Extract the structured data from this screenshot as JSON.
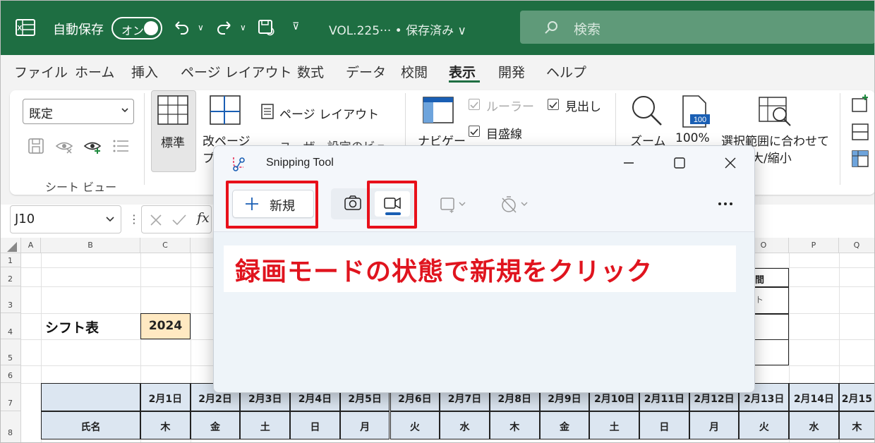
{
  "titlebar": {
    "autosave_label": "自動保存",
    "autosave_toggle": "オン",
    "filename": "VOL.225··· • 保存済み ∨",
    "search_placeholder": "検索",
    "colors": {
      "bg": "#1e6e42"
    }
  },
  "ribbon_tabs": [
    {
      "label": "ファイル"
    },
    {
      "label": "ホーム"
    },
    {
      "label": "挿入"
    },
    {
      "label": "ページ レイアウト"
    },
    {
      "label": "数式"
    },
    {
      "label": "データ"
    },
    {
      "label": "校閲"
    },
    {
      "label": "表示",
      "active": true
    },
    {
      "label": "開発"
    },
    {
      "label": "ヘルプ"
    }
  ],
  "ribbon": {
    "sheet_view_select": "既定",
    "sheet_view_group": "シート ビュー",
    "normal": "標準",
    "page_break_line1": "改ページ",
    "page_break_line2": "プ",
    "page_layout": "ページ レイアウト",
    "custom_view": "ユーザー設定のビュー",
    "navigator": "ナビゲー",
    "ruler": "ルーラー",
    "gridlines": "目盛線",
    "headings": "見出し",
    "zoom": "ズーム",
    "zoom100": "100%",
    "zoom100_icon_text": "100",
    "zoom_selection_line1": "選択範囲に合わせて",
    "zoom_selection_line2": "拡大/縮小"
  },
  "formula_bar": {
    "name_box": "J10",
    "fx": "fx"
  },
  "grid": {
    "col_headers": [
      "A",
      "B",
      "C",
      "O",
      "P",
      "Q"
    ],
    "row_headers": [
      "1",
      "2",
      "3",
      "4",
      "5",
      "6",
      "7",
      "8"
    ],
    "shift_title": "シフト表",
    "year": "2024",
    "right_box_top": "間",
    "right_box_mid": "ト",
    "name_header": "氏名",
    "dates": [
      "2月1日",
      "2月2日",
      "2月3日",
      "2月4日",
      "2月5日",
      "2月6日",
      "2月7日",
      "2月8日",
      "2月9日",
      "2月10日",
      "2月11日",
      "2月12日",
      "2月13日",
      "2月14日",
      "2月15"
    ],
    "days": [
      "木",
      "金",
      "土",
      "日",
      "月",
      "火",
      "水",
      "木",
      "金",
      "土",
      "日",
      "月",
      "火",
      "水",
      "木"
    ]
  },
  "snipping_tool": {
    "title": "Snipping Tool",
    "new_label": "新規",
    "annotation": "録画モードの状態で新規をクリック",
    "highlight_color": "#e8101a",
    "annotation_color": "#e0141e"
  }
}
